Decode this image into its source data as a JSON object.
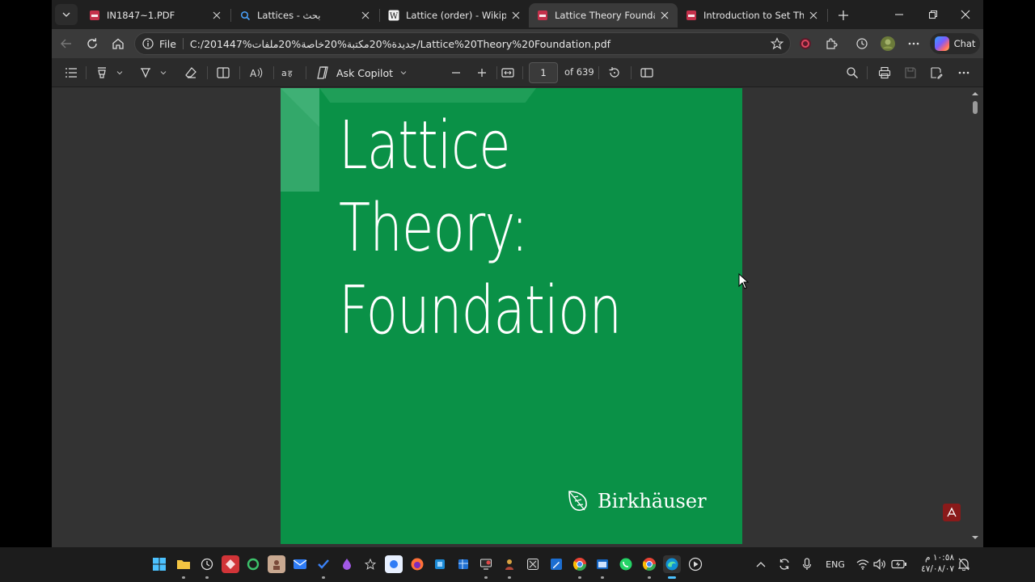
{
  "tabs": [
    {
      "title": "IN1847~1.PDF",
      "icon": "pdf-icon",
      "active": false
    },
    {
      "title": "Lattices - بحث",
      "icon": "search-icon",
      "active": false
    },
    {
      "title": "Lattice (order) - Wikipedia",
      "icon": "wikipedia-icon",
      "active": false
    },
    {
      "title": "Lattice Theory Foundation.pdf",
      "icon": "pdf-icon",
      "active": true
    },
    {
      "title": "Introduction to Set Theory,",
      "icon": "pdf-icon",
      "active": false
    }
  ],
  "address": {
    "scheme_label": "File",
    "url": "C:/201447%جديدة%20مكتبة%20خاصة%20ملفات/Lattice%20Theory%20Foundation.pdf"
  },
  "toolbar": {
    "chat_label": "Chat",
    "ask_copilot_label": "Ask Copilot",
    "page_current": "1",
    "page_total_label": "of 639"
  },
  "document": {
    "title_lines": [
      "Lattice",
      "Theory:",
      "Foundation"
    ],
    "publisher": "Birkhäuser",
    "background_color": "#0a9147"
  },
  "taskbar": {
    "language": "ENG",
    "clock_time": "١٠:٥٨ م",
    "clock_date": "٤٧/٠٨/٠٧"
  },
  "colors": {
    "accent": "#0a9147",
    "chrome_dark": "#202020",
    "chrome": "#3a3a3a",
    "pdf_toolbar": "#2b2b2b",
    "doc_background": "#333333"
  }
}
